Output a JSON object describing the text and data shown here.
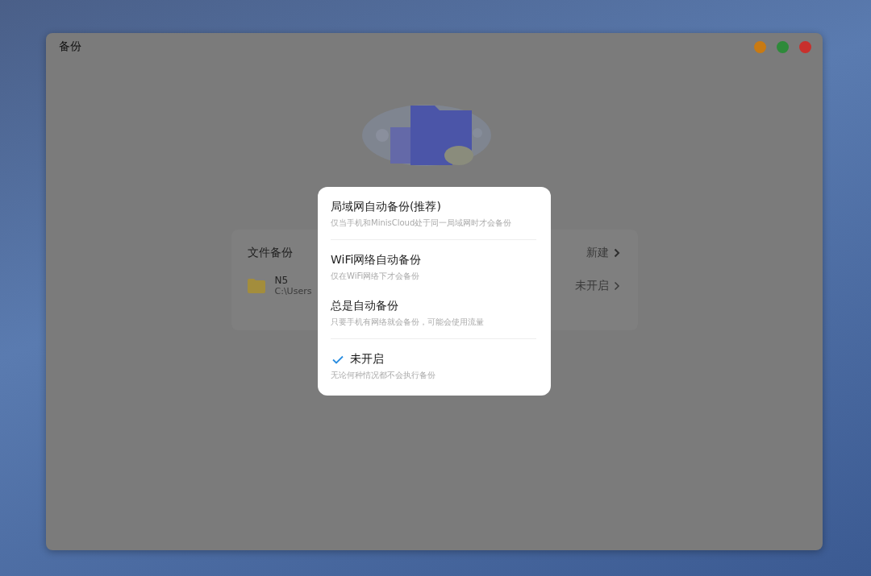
{
  "window": {
    "title": "备份"
  },
  "backup_card": {
    "title": "文件备份",
    "action": "新建",
    "items": [
      {
        "name": "N5",
        "path": "C:\\Users",
        "status": "未开启"
      }
    ]
  },
  "mode_menu": {
    "options": [
      {
        "title": "局域网自动备份(推荐)",
        "description": "仅当手机和MinisCloud处于同一局域网时才会备份",
        "selected": false,
        "divider_below": true
      },
      {
        "title": "WiFi网络自动备份",
        "description": "仅在WiFi网络下才会备份",
        "selected": false,
        "divider_below": false
      },
      {
        "title": "总是自动备份",
        "description": "只要手机有网络就会备份，可能会使用流量",
        "selected": false,
        "divider_below": true
      },
      {
        "title": "未开启",
        "description": "无论何种情况都不会执行备份",
        "selected": true,
        "divider_below": false
      }
    ]
  }
}
